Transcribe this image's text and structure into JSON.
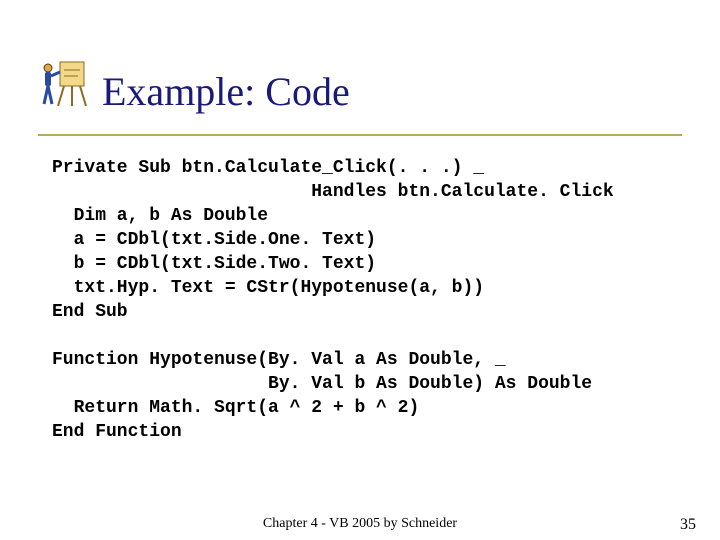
{
  "title": "Example: Code",
  "code_lines": [
    "Private Sub btn.Calculate_Click(. . .) _",
    "                        Handles btn.Calculate. Click",
    "  Dim a, b As Double",
    "  a = CDbl(txt.Side.One. Text)",
    "  b = CDbl(txt.Side.Two. Text)",
    "  txt.Hyp. Text = CStr(Hypotenuse(a, b))",
    "End Sub",
    "",
    "Function Hypotenuse(By. Val a As Double, _",
    "                    By. Val b As Double) As Double",
    "  Return Math. Sqrt(a ^ 2 + b ^ 2)",
    "End Function"
  ],
  "footer": {
    "text": "Chapter 4 - VB 2005 by Schneider",
    "page": "35"
  },
  "icon_name": "figure-easel-icon"
}
